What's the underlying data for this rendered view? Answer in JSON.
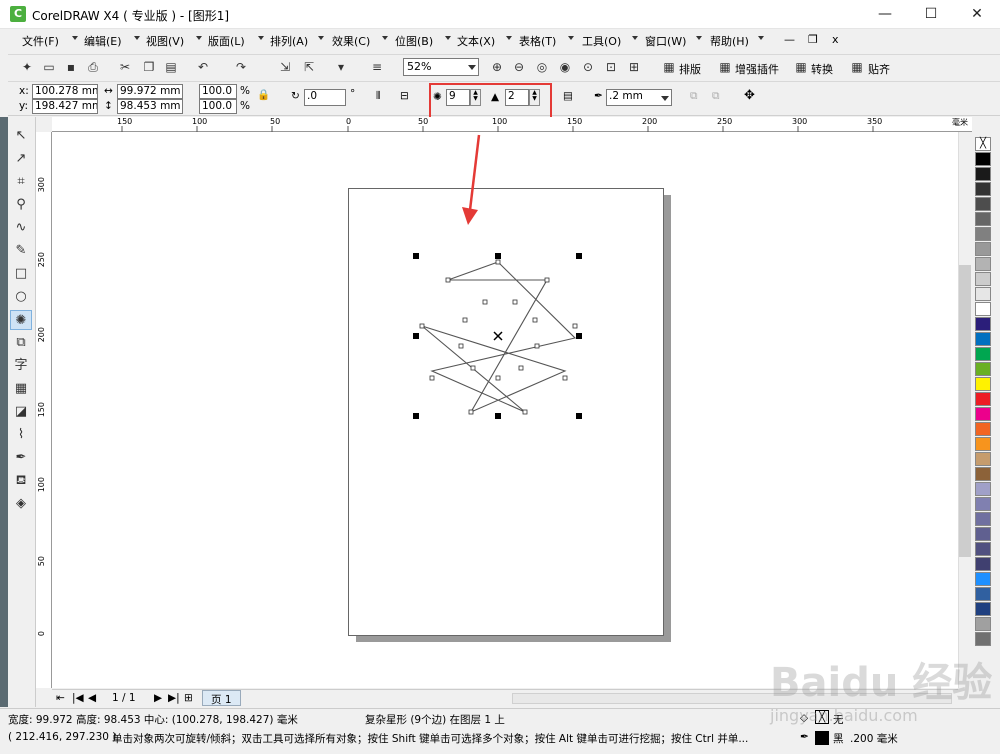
{
  "app": {
    "title": "CorelDRAW X4 ( 专业版 ) - [图形1]",
    "icon_letter": "C"
  },
  "window_buttons": [
    "—",
    "☐",
    "✕"
  ],
  "menu": [
    "文件(F)",
    "编辑(E)",
    "视图(V)",
    "版面(L)",
    "排列(A)",
    "效果(C)",
    "位图(B)",
    "文本(X)",
    "表格(T)",
    "工具(O)",
    "窗口(W)",
    "帮助(H)"
  ],
  "menu_right": [
    "—",
    "❐",
    "x"
  ],
  "toolbar": {
    "zoom": "52%",
    "buttons": [
      "排版",
      "增强插件",
      "转换",
      "贴齐"
    ]
  },
  "propbar": {
    "x_label": "x:",
    "x": "100.278 mm",
    "y_label": "y:",
    "y": "198.427 mm",
    "w": "99.972 mm",
    "h": "98.453 mm",
    "sx": "100.0",
    "sy": "100.0",
    "pct": "%",
    "rot": ".0",
    "deg": "°",
    "points": "9",
    "sharpness": "2",
    "outline": ".2 mm"
  },
  "ruler": {
    "h_ticks": [
      "150",
      "100",
      "50",
      "0",
      "50",
      "100",
      "150",
      "200",
      "250",
      "300",
      "350"
    ],
    "h_unit": "毫米",
    "v_ticks": [
      "300",
      "250",
      "200",
      "150",
      "100",
      "50",
      "0"
    ]
  },
  "pagenav": {
    "counter": "1 / 1",
    "tab": "页 1"
  },
  "status": {
    "dims": "宽度: 99.972  高度: 98.453  中心: (100.278, 198.427)  毫米",
    "object": "复杂星形 (9个边) 在图层 1 上",
    "fill_label": "无",
    "coords": "( 212.416, 297.230 )",
    "hint": "单击对象两次可旋转/倾斜；双击工具可选择所有对象；按住 Shift 键单击可选择多个对象；按住 Alt 键单击可进行挖掘；按住 Ctrl 并单...",
    "outline_color": "黑",
    "outline_width": ".200 毫米"
  },
  "watermark": {
    "text": "Baidu 经验",
    "sub": "jingyan.baidu.com"
  },
  "palette": [
    "#ffffff",
    "#000000",
    "#1a1a1a",
    "#333333",
    "#4d4d4d",
    "#666666",
    "#808080",
    "#999999",
    "#b3b3b3",
    "#cccccc",
    "#e6e6e6",
    "#ffffff",
    "#2b1e7a",
    "#0070c0",
    "#00a650",
    "#6ab023",
    "#fff200",
    "#ed1c24",
    "#ec008c",
    "#f26522",
    "#f7941d",
    "#c69c6d",
    "#8c6239",
    "#a0a0c8",
    "#8080b0",
    "#7070a0",
    "#606090",
    "#505080",
    "#404070",
    "#1e90ff",
    "#3060a0",
    "#204080",
    "#a0a0a0",
    "#707070"
  ]
}
